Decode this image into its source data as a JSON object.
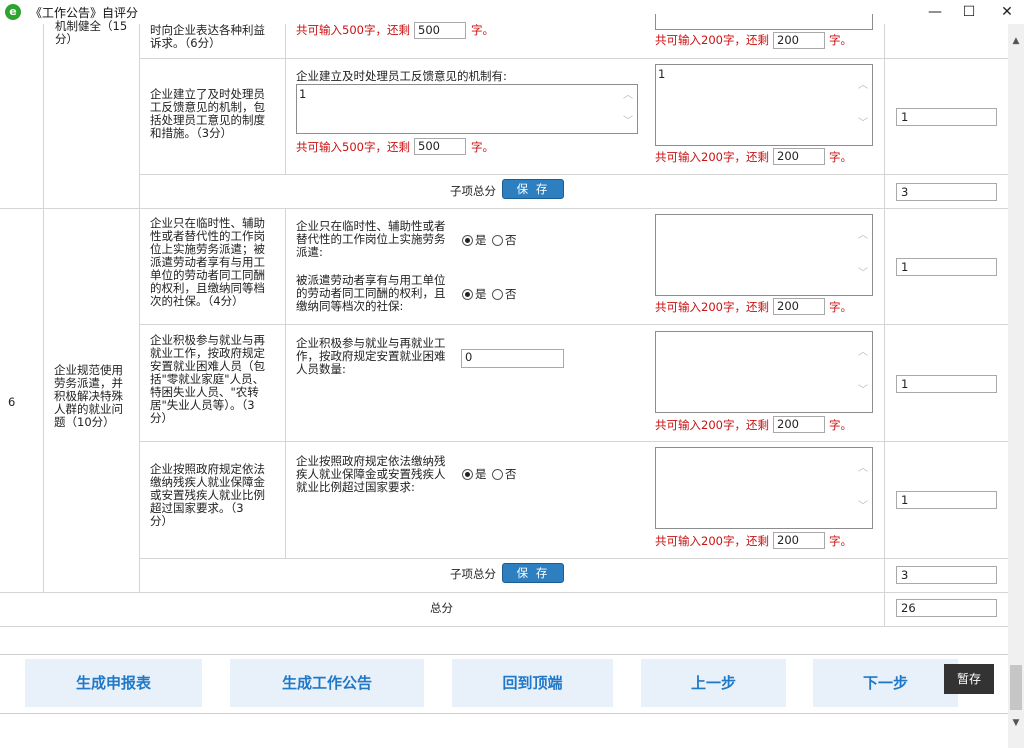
{
  "window": {
    "title": "《工作公告》自评分",
    "minimize": "—",
    "maximize": "☐",
    "close": "✕",
    "app_icon": "e"
  },
  "top_partial": {
    "category_text": "机制健全（15\n分）",
    "criterion_text": "时向企业表达各种利益\n诉求。（6分）",
    "limit_500_prefix": "共可输入500字，还剩",
    "limit_500_value": "500",
    "limit_suffix": "字。",
    "limit_200_prefix": "共可输入200字，还剩",
    "limit_200_value": "200"
  },
  "row_feedback": {
    "criterion_text": "企业建立了及时处理员\n工反馈意见的机制，包\n括处理员工意见的制度\n和措施。（3分）",
    "question": "企业建立及时处理员工反馈意见的机制有:",
    "answer_value": "1",
    "remark_value": "1",
    "limit_500_prefix": "共可输入500字，还剩",
    "limit_500_value": "500",
    "limit_200_prefix": "共可输入200字，还剩",
    "limit_200_value": "200",
    "limit_suffix": "字。",
    "score": "1"
  },
  "subtotal_1": {
    "label": "子项总分",
    "save": "保 存",
    "score": "3"
  },
  "section6": {
    "number": "6",
    "category_text": "企业规范使用\n劳务派遣，并\n积极解决特殊\n人群的就业问\n题（10分）",
    "rows": [
      {
        "criterion_text": "企业只在临时性、辅助\n性或者替代性的工作岗\n位上实施劳务派遣；被\n派遣劳动者享有与用工\n单位的劳动者同工同酬\n的权利，且缴纳同等档\n次的社保。（4分）",
        "q1": "企业只在临时性、辅助性或者\n替代性的工作岗位上实施劳务\n派遣:",
        "q2": "被派遣劳动者享有与用工单位\n的劳动者同工同酬的权利，且\n缴纳同等档次的社保:",
        "yes": "是",
        "no": "否",
        "limit_200_prefix": "共可输入200字，还剩",
        "limit_200_value": "200",
        "limit_suffix": "字。",
        "score": "1"
      },
      {
        "criterion_text": "企业积极参与就业与再\n就业工作，按政府规定\n安置就业困难人员（包\n括\"零就业家庭\"人员、\n特困失业人员、\"农转\n居\"失业人员等）。（3\n分）",
        "q1": "企业积极参与就业与再就业工\n作，按政府规定安置就业困难\n人员数量:",
        "q1_value": "0",
        "limit_200_prefix": "共可输入200字，还剩",
        "limit_200_value": "200",
        "limit_suffix": "字。",
        "score": "1"
      },
      {
        "criterion_text": "企业按照政府规定依法\n缴纳残疾人就业保障金\n或安置残疾人就业比例\n超过国家要求。（3\n分）",
        "q1": "企业按照政府规定依法缴纳残\n疾人就业保障金或安置残疾人\n就业比例超过国家要求:",
        "yes": "是",
        "no": "否",
        "limit_200_prefix": "共可输入200字，还剩",
        "limit_200_value": "200",
        "limit_suffix": "字。",
        "score": "1"
      }
    ]
  },
  "subtotal_2": {
    "label": "子项总分",
    "save": "保 存",
    "score": "3"
  },
  "total": {
    "label": "总分",
    "score": "26"
  },
  "bottom_buttons": {
    "generate_report": "生成申报表",
    "generate_notice": "生成工作公告",
    "back_to_top": "回到顶端",
    "prev": "上一步",
    "next": "下一步",
    "temp_save": "暂存"
  }
}
